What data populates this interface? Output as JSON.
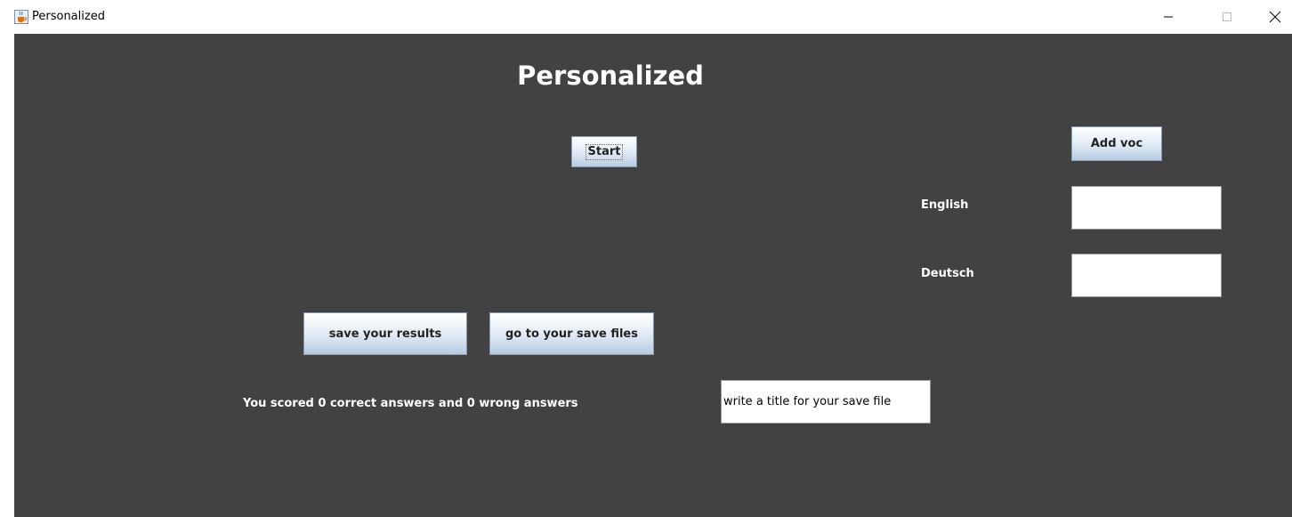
{
  "window": {
    "title": "Personalized",
    "icon": "java-cup-icon",
    "controls": [
      "minimize",
      "maximize",
      "close"
    ]
  },
  "main": {
    "heading": "Personalized",
    "start_label": "Start",
    "add_voc_label": "Add voc",
    "english_label": "English",
    "english_value": "",
    "deutsch_label": "Deutsch",
    "deutsch_value": "",
    "save_results_label": "save your results",
    "go_to_save_files_label": "go to your save files",
    "score_text": "You scored 0 correct answers and 0 wrong answers",
    "save_title_value": "write a title for your save file"
  },
  "colors": {
    "background": "#424242",
    "text": "#ffffff",
    "button_top": "#ffffff",
    "button_bottom": "#b6cbe2"
  }
}
